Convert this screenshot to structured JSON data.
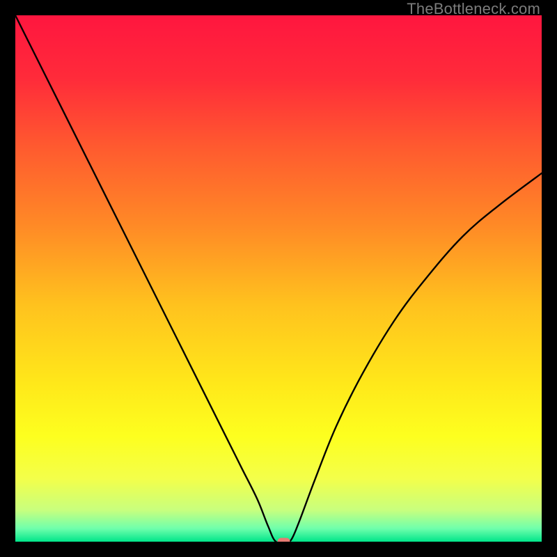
{
  "watermark": "TheBottleneck.com",
  "chart_data": {
    "type": "line",
    "title": "",
    "xlabel": "",
    "ylabel": "",
    "xlim": [
      0,
      100
    ],
    "ylim": [
      0,
      100
    ],
    "grid": false,
    "legend": false,
    "background_gradient": {
      "stops": [
        {
          "offset": 0.0,
          "color": "#ff163f"
        },
        {
          "offset": 0.12,
          "color": "#ff2b3a"
        },
        {
          "offset": 0.25,
          "color": "#ff5a2f"
        },
        {
          "offset": 0.4,
          "color": "#ff8a26"
        },
        {
          "offset": 0.55,
          "color": "#ffc21e"
        },
        {
          "offset": 0.7,
          "color": "#ffe81a"
        },
        {
          "offset": 0.8,
          "color": "#fdff1f"
        },
        {
          "offset": 0.88,
          "color": "#f3ff4a"
        },
        {
          "offset": 0.94,
          "color": "#c8ff7e"
        },
        {
          "offset": 0.975,
          "color": "#6fffac"
        },
        {
          "offset": 1.0,
          "color": "#00e58a"
        }
      ]
    },
    "series": [
      {
        "name": "bottleneck-curve",
        "x": [
          0,
          2,
          5,
          8,
          12,
          16,
          20,
          24,
          28,
          32,
          36,
          40,
          43,
          46,
          48,
          49.5,
          51.5,
          52.5,
          54,
          57,
          61,
          66,
          72,
          78,
          85,
          92,
          100
        ],
        "y": [
          100,
          96,
          90,
          84,
          76,
          68,
          60,
          52,
          44,
          36,
          28,
          20,
          14,
          8,
          3,
          0,
          0,
          0.5,
          4,
          12,
          22,
          32,
          42,
          50,
          58,
          64,
          70
        ]
      }
    ],
    "marker": {
      "name": "optimal-point",
      "x": 51,
      "y": 0,
      "color": "#e77b73",
      "shape": "pill"
    }
  }
}
